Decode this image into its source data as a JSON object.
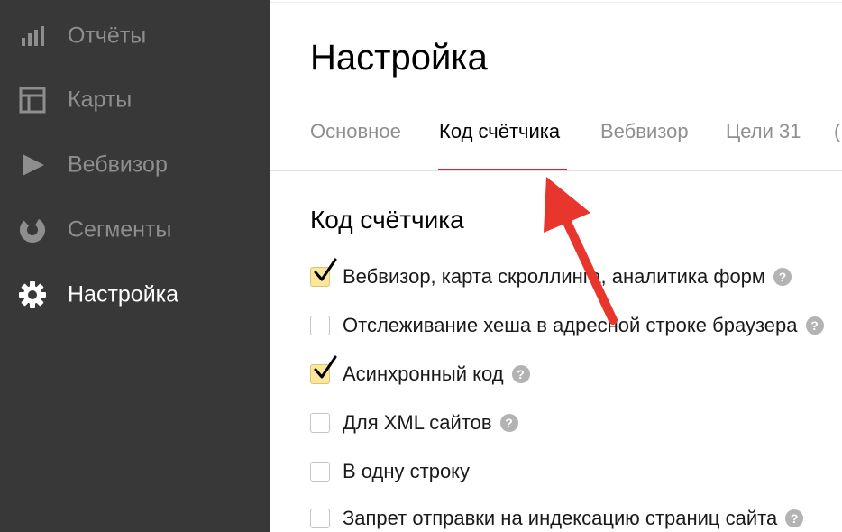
{
  "sidebar": {
    "items": [
      {
        "label": "Отчёты",
        "icon": "bar-chart-icon"
      },
      {
        "label": "Карты",
        "icon": "layout-map-icon"
      },
      {
        "label": "Вебвизор",
        "icon": "play-icon"
      },
      {
        "label": "Сегменты",
        "icon": "donut-segment-icon"
      },
      {
        "label": "Настройка",
        "icon": "gear-icon",
        "active": true
      }
    ]
  },
  "main": {
    "title": "Настройка",
    "tabs": [
      {
        "label": "Основное"
      },
      {
        "label": "Код счётчика",
        "active": true
      },
      {
        "label": "Вебвизор"
      },
      {
        "label": "Цели 31"
      },
      {
        "label": "("
      }
    ],
    "section_title": "Код счётчика",
    "options": [
      {
        "label": "Вебвизор, карта скроллинга, аналитика форм",
        "checked": true,
        "help": true
      },
      {
        "label": "Отслеживание хеша в адресной строке браузера",
        "checked": false,
        "help": true
      },
      {
        "label": "Асинхронный код",
        "checked": true,
        "help": true
      },
      {
        "label": "Для XML сайтов",
        "checked": false,
        "help": true
      },
      {
        "label": "В одну строку",
        "checked": false,
        "help": false
      },
      {
        "label": "Запрет отправки на индексацию страниц сайта",
        "checked": false,
        "help": true
      }
    ],
    "help_glyph": "?"
  },
  "colors": {
    "sidebar_bg": "#383838",
    "accent_underline": "#e3242b",
    "arrow": "#e8362c",
    "checkbox_checked": "#fbe69a"
  }
}
